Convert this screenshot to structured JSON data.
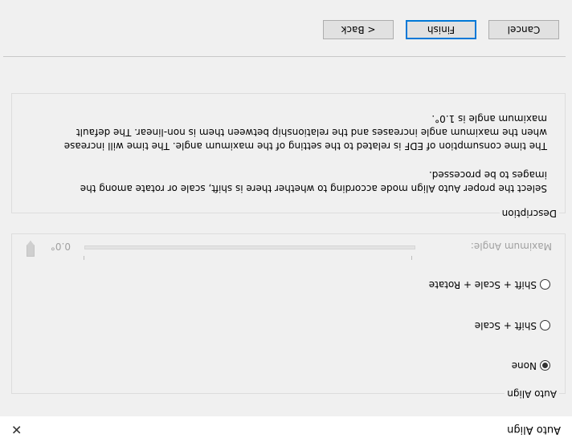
{
  "window": {
    "title": "Auto Align",
    "close_icon": "close-icon"
  },
  "auto_align": {
    "legend": "Auto Align",
    "options": [
      {
        "label": "None",
        "checked": true
      },
      {
        "label": "Shift + Scale",
        "checked": false
      },
      {
        "label": "Shift + Scale + Rotate",
        "checked": false
      }
    ],
    "max_angle_label": "Maximum Angle:",
    "max_angle_value": "0.0°",
    "slider_fraction": 0.0,
    "slider_enabled": false
  },
  "description": {
    "legend": "Description",
    "line1": "Select the proper Auto Align mode according to whether there is shift, scale or rotate among the",
    "line2": "images to be processed.",
    "line3": "The time consumption of EDF is related to the setting of the maximum angle. The time will increase",
    "line4": "when the maximum angle increases and the relationship between them is non-linear. The default",
    "line5": "maximum angle is 1.0°."
  },
  "buttons": {
    "back": "< Back",
    "finish": "Finish",
    "cancel": "Cancel"
  },
  "colors": {
    "focus_border": "#0078d7",
    "disabled_text": "#a0a0a0"
  }
}
